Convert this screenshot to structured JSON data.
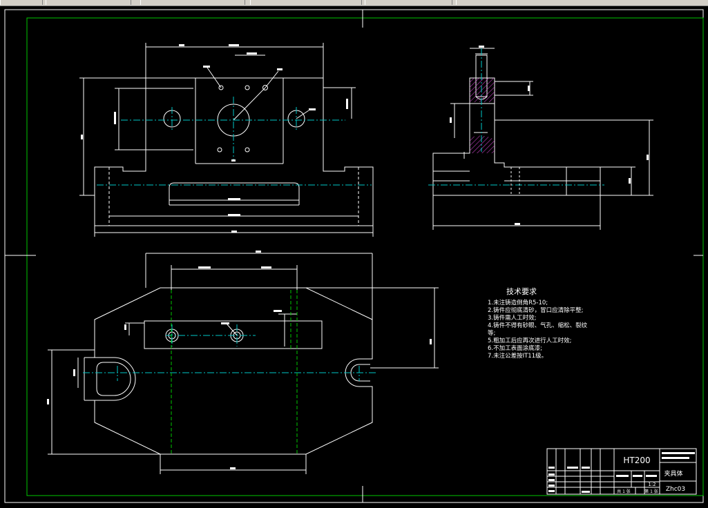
{
  "window": {
    "toolbar_tabs": [
      "",
      "",
      "",
      "",
      ""
    ]
  },
  "technical_requirements": {
    "title": "技术要求",
    "items": [
      "1.未注铸造倒角R5-10;",
      "2.铸件应彻底清砂，冒口应清除平整;",
      "3.铸件需人工时效;",
      "4.铸件不得有砂眼、气孔、缩松、裂纹",
      "等;",
      "5.粗加工后应再次进行人工时效;",
      "6.不加工表面涂底漆;",
      "7.未注公差按IT11级。"
    ]
  },
  "title_block": {
    "material": "HT200",
    "part_name": "夹具体",
    "drawing_no": "Zhc03",
    "scale": "1:2",
    "sheet_total": "共 1 张",
    "sheet_no": "第 1 张"
  },
  "colors": {
    "line": "#ffffff",
    "border": "#00c800",
    "center": "#00c8c8",
    "hatch": "#c040c0"
  }
}
